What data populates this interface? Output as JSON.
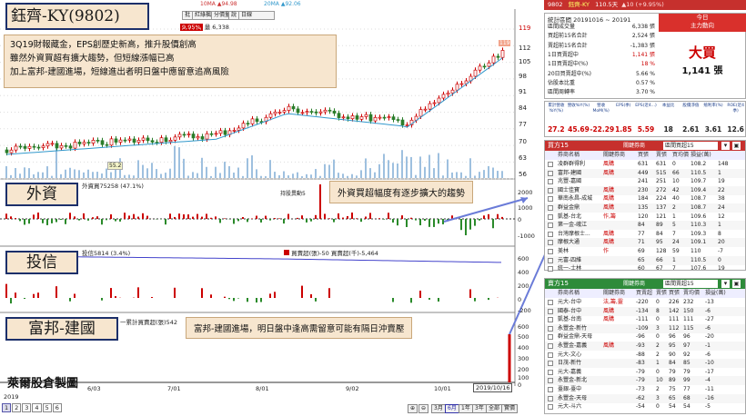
{
  "legend_top": {
    "ma10": "10MA ▲94.98",
    "ma20": "20MA ▲92.06"
  },
  "toolbar": {
    "items": [
      "批",
      "紅綠楓",
      "分價量",
      "說",
      "日線"
    ]
  },
  "price_bar": {
    "pct": "9.95%",
    "volume": "量 6,338"
  },
  "price_axis": [
    "119",
    "112",
    "105",
    "98",
    "91",
    "84",
    "77",
    "70",
    "63",
    "56"
  ],
  "badge_high": "119",
  "annotation_low": "55.2",
  "title_tag": "鈺齊-KY(9802)",
  "note_lines": [
    "3Q19財報藏金，EPS創歷史新高，推升股價創高",
    "雖然外資買超有擴大趨勢，但短線漲幅已高",
    "加上富邦-建國進場，短線進出者明日盤中應留意追高風險"
  ],
  "foreign": {
    "tag": "外資",
    "label": "外資買75258 (47.1%)",
    "sub": "持股異動5",
    "callout": "外資買超幅度有逐步擴大的趨勢",
    "axis": [
      "2000",
      "1000",
      "0",
      "-1000"
    ]
  },
  "trust": {
    "tag": "投信",
    "label": "投信5814 (3.4%)",
    "legend": "買賣超(張)-50 買賣超(千)-5,464",
    "axis": [
      "600",
      "400",
      "200",
      "0",
      "-200"
    ]
  },
  "branch": {
    "tag": "富邦-建國",
    "label": "一累計買賣超(張)542",
    "callout": "富邦-建國進場，明日盤中逢高需留意可能有隔日沖賣壓",
    "axis": [
      "600",
      "500",
      "400",
      "300",
      "200",
      "100",
      "0"
    ]
  },
  "x_axis": {
    "year": "2019",
    "dates": [
      "6/03",
      "7/01",
      "8/01",
      "9/02",
      "10/01"
    ],
    "current": "2019/10/16"
  },
  "watermark": "萊爾股倉製圖",
  "tabs": [
    "1",
    "2",
    "3",
    "4",
    "5",
    "6"
  ],
  "bottom_buttons": [
    "3月",
    "6月",
    "1年",
    "3年",
    "全部",
    "實價"
  ],
  "quote": {
    "id": "9802",
    "name": "鈺齊-KY",
    "price": "110.5天",
    "change": "▲10 (+9.95%)"
  },
  "stats": {
    "period": "統計區間 20191016 ~ 20191",
    "rows": [
      {
        "k": "區間成交量",
        "v": "6,338 張",
        "c": "#222"
      },
      {
        "k": "買超前15名合計",
        "v": "2,524 張",
        "c": "#222"
      },
      {
        "k": "賣超前15名合計",
        "v": "-1,383 張",
        "c": "#222"
      },
      {
        "k": "1日買賣超中",
        "v": "1,141 張",
        "c": "#c00"
      },
      {
        "k": "1日買賣超中(%)",
        "v": "18 %",
        "c": "#c00"
      },
      {
        "k": "20日買賣超中(%)",
        "v": "5.66 %",
        "c": "#222"
      },
      {
        "k": "佔股本比重",
        "v": "0.57 %",
        "c": "#222"
      },
      {
        "k": "區間周轉率",
        "v": "3.70 %",
        "c": "#222"
      }
    ],
    "today": "今日",
    "main_force": "主力動向",
    "verdict": "大買",
    "verdict_val": "1,141 張"
  },
  "fin": {
    "headers": [
      "累計營收YoY(%)",
      "營收YoY(%)",
      "營收MoM(%)",
      "EPS(季)",
      "EPS(近4...)",
      "本益比",
      "股價淨值",
      "殖利率(%)",
      "ROE(近4季)"
    ],
    "values": [
      "27.2",
      "45.69",
      "-22.29",
      "1.85",
      "5.59",
      "18",
      "2.61",
      "3.61",
      "12.6"
    ],
    "colors": [
      "#c00",
      "#c00",
      "#c00",
      "#c00",
      "#c00",
      "#222",
      "#222",
      "#222",
      "#222"
    ]
  },
  "buy": {
    "title": "買方15",
    "sel": "關鍵券商",
    "dropdown": "區間買超15",
    "cols": [
      "券商名稱",
      "關鍵券商",
      "買張",
      "賣張",
      "買均價",
      "損益(萬)"
    ],
    "rows": [
      [
        "凌群群得利",
        "風購",
        "631",
        "631",
        "0",
        "108.2",
        "148"
      ],
      [
        "富邦-建國",
        "風購",
        "449",
        "515",
        "66",
        "110.5",
        "1"
      ],
      [
        "兆豐-嘉國",
        "",
        "241",
        "251",
        "10",
        "109.7",
        "19"
      ],
      [
        "國士佳寶",
        "風購",
        "230",
        "272",
        "42",
        "109.4",
        "22"
      ],
      [
        "華南永昌-成城",
        "風購",
        "184",
        "224",
        "40",
        "108.7",
        "38"
      ],
      [
        "群益金鼎",
        "風購",
        "135",
        "137",
        "2",
        "108.7",
        "24"
      ],
      [
        "凱基-台北",
        "作,籌",
        "120",
        "121",
        "1",
        "109.6",
        "12"
      ],
      [
        "第一金-峨江",
        "",
        "84",
        "89",
        "5",
        "110.3",
        "1"
      ],
      [
        "台灣摩根士...",
        "風購",
        "77",
        "84",
        "7",
        "109.3",
        "8"
      ],
      [
        "摩根大通",
        "風購",
        "71",
        "95",
        "24",
        "109.1",
        "20"
      ],
      [
        "美林",
        "作",
        "69",
        "128",
        "59",
        "110",
        "-7"
      ],
      [
        "元富-四維",
        "",
        "65",
        "66",
        "1",
        "110.5",
        "0"
      ],
      [
        "統一-士林",
        "",
        "60",
        "67",
        "7",
        "107.6",
        "19"
      ]
    ]
  },
  "sell": {
    "title": "賣方15",
    "sel": "關鍵券商",
    "dropdown": "區間賣超15",
    "cols": [
      "券商名稱",
      "關鍵券商",
      "買賣超",
      "賣張",
      "買張",
      "賣均價",
      "損益(萬)"
    ],
    "rows": [
      [
        "元大-台中",
        "法,籌,靈",
        "-220",
        "0",
        "226",
        "232",
        "-13"
      ],
      [
        "國泰-台中",
        "風購",
        "-134",
        "8",
        "142",
        "150",
        "-6"
      ],
      [
        "凱基-台南",
        "風購",
        "-111",
        "0",
        "111",
        "111",
        "-27"
      ],
      [
        "永豐金-新竹",
        "",
        "-109",
        "3",
        "112",
        "115",
        "-6"
      ],
      [
        "群益金鼎-天母",
        "",
        "-96",
        "0",
        "96",
        "96",
        "-20"
      ],
      [
        "永豐金-嘉義",
        "風購",
        "-93",
        "2",
        "95",
        "97",
        "-1"
      ],
      [
        "元大-文心",
        "",
        "-88",
        "2",
        "90",
        "92",
        "-6"
      ],
      [
        "日茂-新竹",
        "",
        "-83",
        "1",
        "84",
        "85",
        "-10"
      ],
      [
        "元大-嘉義",
        "",
        "-79",
        "0",
        "79",
        "79",
        "-17"
      ],
      [
        "永豐金-新北",
        "",
        "-79",
        "10",
        "89",
        "99",
        "-4"
      ],
      [
        "臺銀-臺中",
        "",
        "-73",
        "2",
        "75",
        "77",
        "-11"
      ],
      [
        "永豐金-天母",
        "",
        "-62",
        "3",
        "65",
        "68",
        "-16"
      ],
      [
        "元大-斗六",
        "",
        "-54",
        "0",
        "54",
        "54",
        "-5"
      ]
    ]
  }
}
